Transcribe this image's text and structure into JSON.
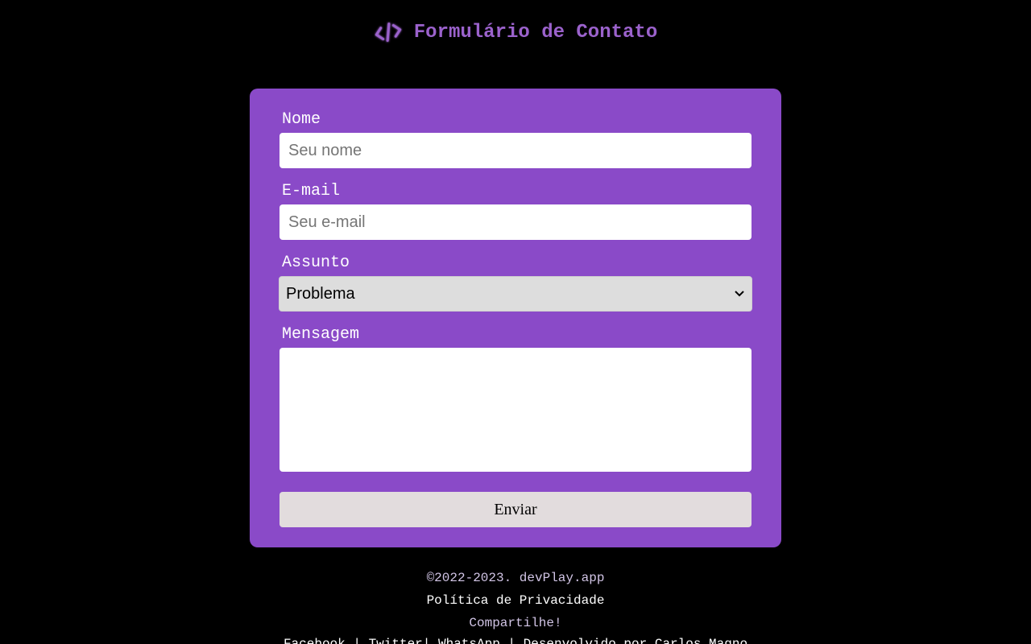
{
  "header": {
    "logo_icon": "code-brackets-icon",
    "title": "Formulário de Contato",
    "accent_color": "#9b62cc"
  },
  "form": {
    "card_color": "#8a4ac8",
    "name": {
      "label": "Nome",
      "placeholder": "Seu nome",
      "value": ""
    },
    "email": {
      "label": "E-mail",
      "placeholder": "Seu e-mail",
      "value": ""
    },
    "subject": {
      "label": "Assunto",
      "selected": "Problema"
    },
    "message": {
      "label": "Mensagem",
      "value": ""
    },
    "submit_label": "Enviar"
  },
  "footer": {
    "copyright": "©2022-2023. devPlay.app",
    "privacy": "Política de Privacidade",
    "share": "Compartilhe!",
    "links": {
      "facebook": "Facebook",
      "twitter": "Twitter",
      "whatsapp": "WhatsApp",
      "developer": "Desenvolvido por Carlos Magno"
    }
  }
}
